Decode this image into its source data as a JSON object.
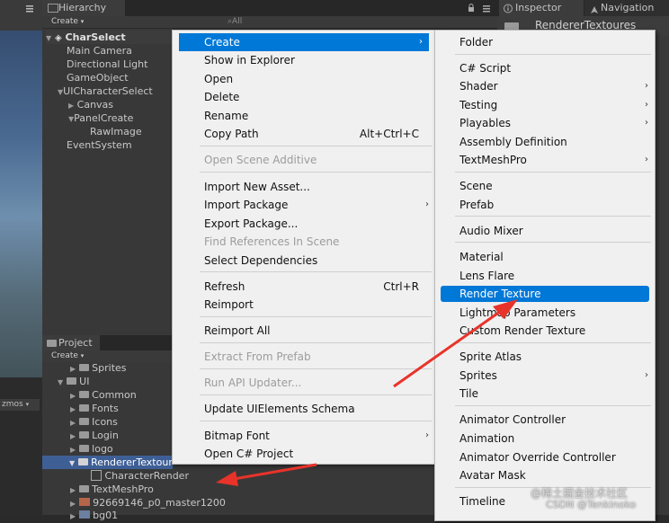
{
  "hierarchy": {
    "tab_label": "Hierarchy",
    "create_label": "Create",
    "search_placeholder": "All",
    "scene_name": "CharSelect",
    "items": [
      {
        "label": "Main Camera"
      },
      {
        "label": "Directional Light"
      },
      {
        "label": "GameObject"
      },
      {
        "label": "UICharacterSelect"
      },
      {
        "label": "Canvas"
      },
      {
        "label": "PanelCreate"
      },
      {
        "label": "RawImage"
      },
      {
        "label": "EventSystem"
      }
    ]
  },
  "inspector": {
    "tab_label": "Inspector",
    "navigation_tab_label": "Navigation",
    "asset_name": "RendererTextoures"
  },
  "scene_view": {
    "gizmos_label": "zmos"
  },
  "project": {
    "tab_label": "Project",
    "create_label": "Create",
    "items": [
      {
        "label": "Sprites"
      },
      {
        "label": "UI"
      },
      {
        "label": "Common"
      },
      {
        "label": "Fonts"
      },
      {
        "label": "Icons"
      },
      {
        "label": "Login"
      },
      {
        "label": "logo"
      },
      {
        "label": "RendererTextour"
      },
      {
        "label": "CharacterRender"
      },
      {
        "label": "TextMeshPro"
      },
      {
        "label": "92669146_p0_master1200"
      },
      {
        "label": "bg01"
      }
    ]
  },
  "context_menu": {
    "items": [
      {
        "label": "Create",
        "submenu": true,
        "highlighted": true
      },
      {
        "label": "Show in Explorer"
      },
      {
        "label": "Open"
      },
      {
        "label": "Delete"
      },
      {
        "label": "Rename"
      },
      {
        "label": "Copy Path",
        "shortcut": "Alt+Ctrl+C"
      },
      {
        "label": "Open Scene Additive",
        "disabled": true
      },
      {
        "label": "Import New Asset..."
      },
      {
        "label": "Import Package",
        "submenu": true
      },
      {
        "label": "Export Package..."
      },
      {
        "label": "Find References In Scene",
        "disabled": true
      },
      {
        "label": "Select Dependencies"
      },
      {
        "label": "Refresh",
        "shortcut": "Ctrl+R"
      },
      {
        "label": "Reimport"
      },
      {
        "label": "Reimport All"
      },
      {
        "label": "Extract From Prefab",
        "disabled": true
      },
      {
        "label": "Run API Updater...",
        "disabled": true
      },
      {
        "label": "Update UIElements Schema"
      },
      {
        "label": "Bitmap Font",
        "submenu": true
      },
      {
        "label": "Open C# Project"
      }
    ]
  },
  "create_submenu": {
    "items": [
      {
        "label": "Folder"
      },
      {
        "label": "C# Script"
      },
      {
        "label": "Shader",
        "submenu": true
      },
      {
        "label": "Testing",
        "submenu": true
      },
      {
        "label": "Playables",
        "submenu": true
      },
      {
        "label": "Assembly Definition"
      },
      {
        "label": "TextMeshPro",
        "submenu": true
      },
      {
        "label": "Scene"
      },
      {
        "label": "Prefab"
      },
      {
        "label": "Audio Mixer"
      },
      {
        "label": "Material"
      },
      {
        "label": "Lens Flare"
      },
      {
        "label": "Render Texture",
        "highlighted": true
      },
      {
        "label": "Lightmap Parameters"
      },
      {
        "label": "Custom Render Texture"
      },
      {
        "label": "Sprite Atlas"
      },
      {
        "label": "Sprites",
        "submenu": true
      },
      {
        "label": "Tile"
      },
      {
        "label": "Animator Controller"
      },
      {
        "label": "Animation"
      },
      {
        "label": "Animator Override Controller"
      },
      {
        "label": "Avatar Mask"
      },
      {
        "label": "Timeline"
      }
    ]
  },
  "annotations": {
    "arrow_color": "#e8332a"
  },
  "watermark": {
    "line1": "@稀土掘金技术社区",
    "line2": "CSDN @Tenkinoko"
  },
  "colors": {
    "highlight": "#0078d7",
    "project_selection": "#3e5f96"
  }
}
